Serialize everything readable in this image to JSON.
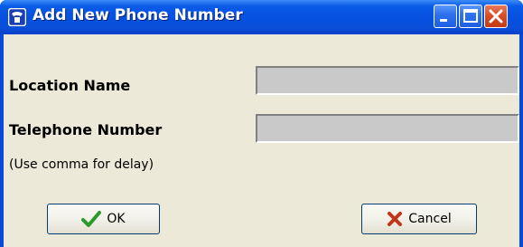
{
  "window": {
    "title": "Add New Phone Number",
    "app_icon": "phone-app-icon",
    "controls": [
      "minimize-icon",
      "maximize-icon",
      "close-icon"
    ]
  },
  "form": {
    "location_label": "Location Name",
    "location_value": "",
    "telephone_label": "Telephone Number",
    "telephone_value": "",
    "hint": "(Use comma for delay)"
  },
  "buttons": {
    "ok_label": "OK",
    "ok_icon": "checkmark-icon",
    "cancel_label": "Cancel",
    "cancel_icon": "x-cross-icon"
  },
  "colors": {
    "titlebar": "#0550e0",
    "client_background": "#ece9d8",
    "field_background": "#c9c9c9",
    "ok_icon": "#2a9a2a",
    "cancel_icon": "#c0361a"
  }
}
